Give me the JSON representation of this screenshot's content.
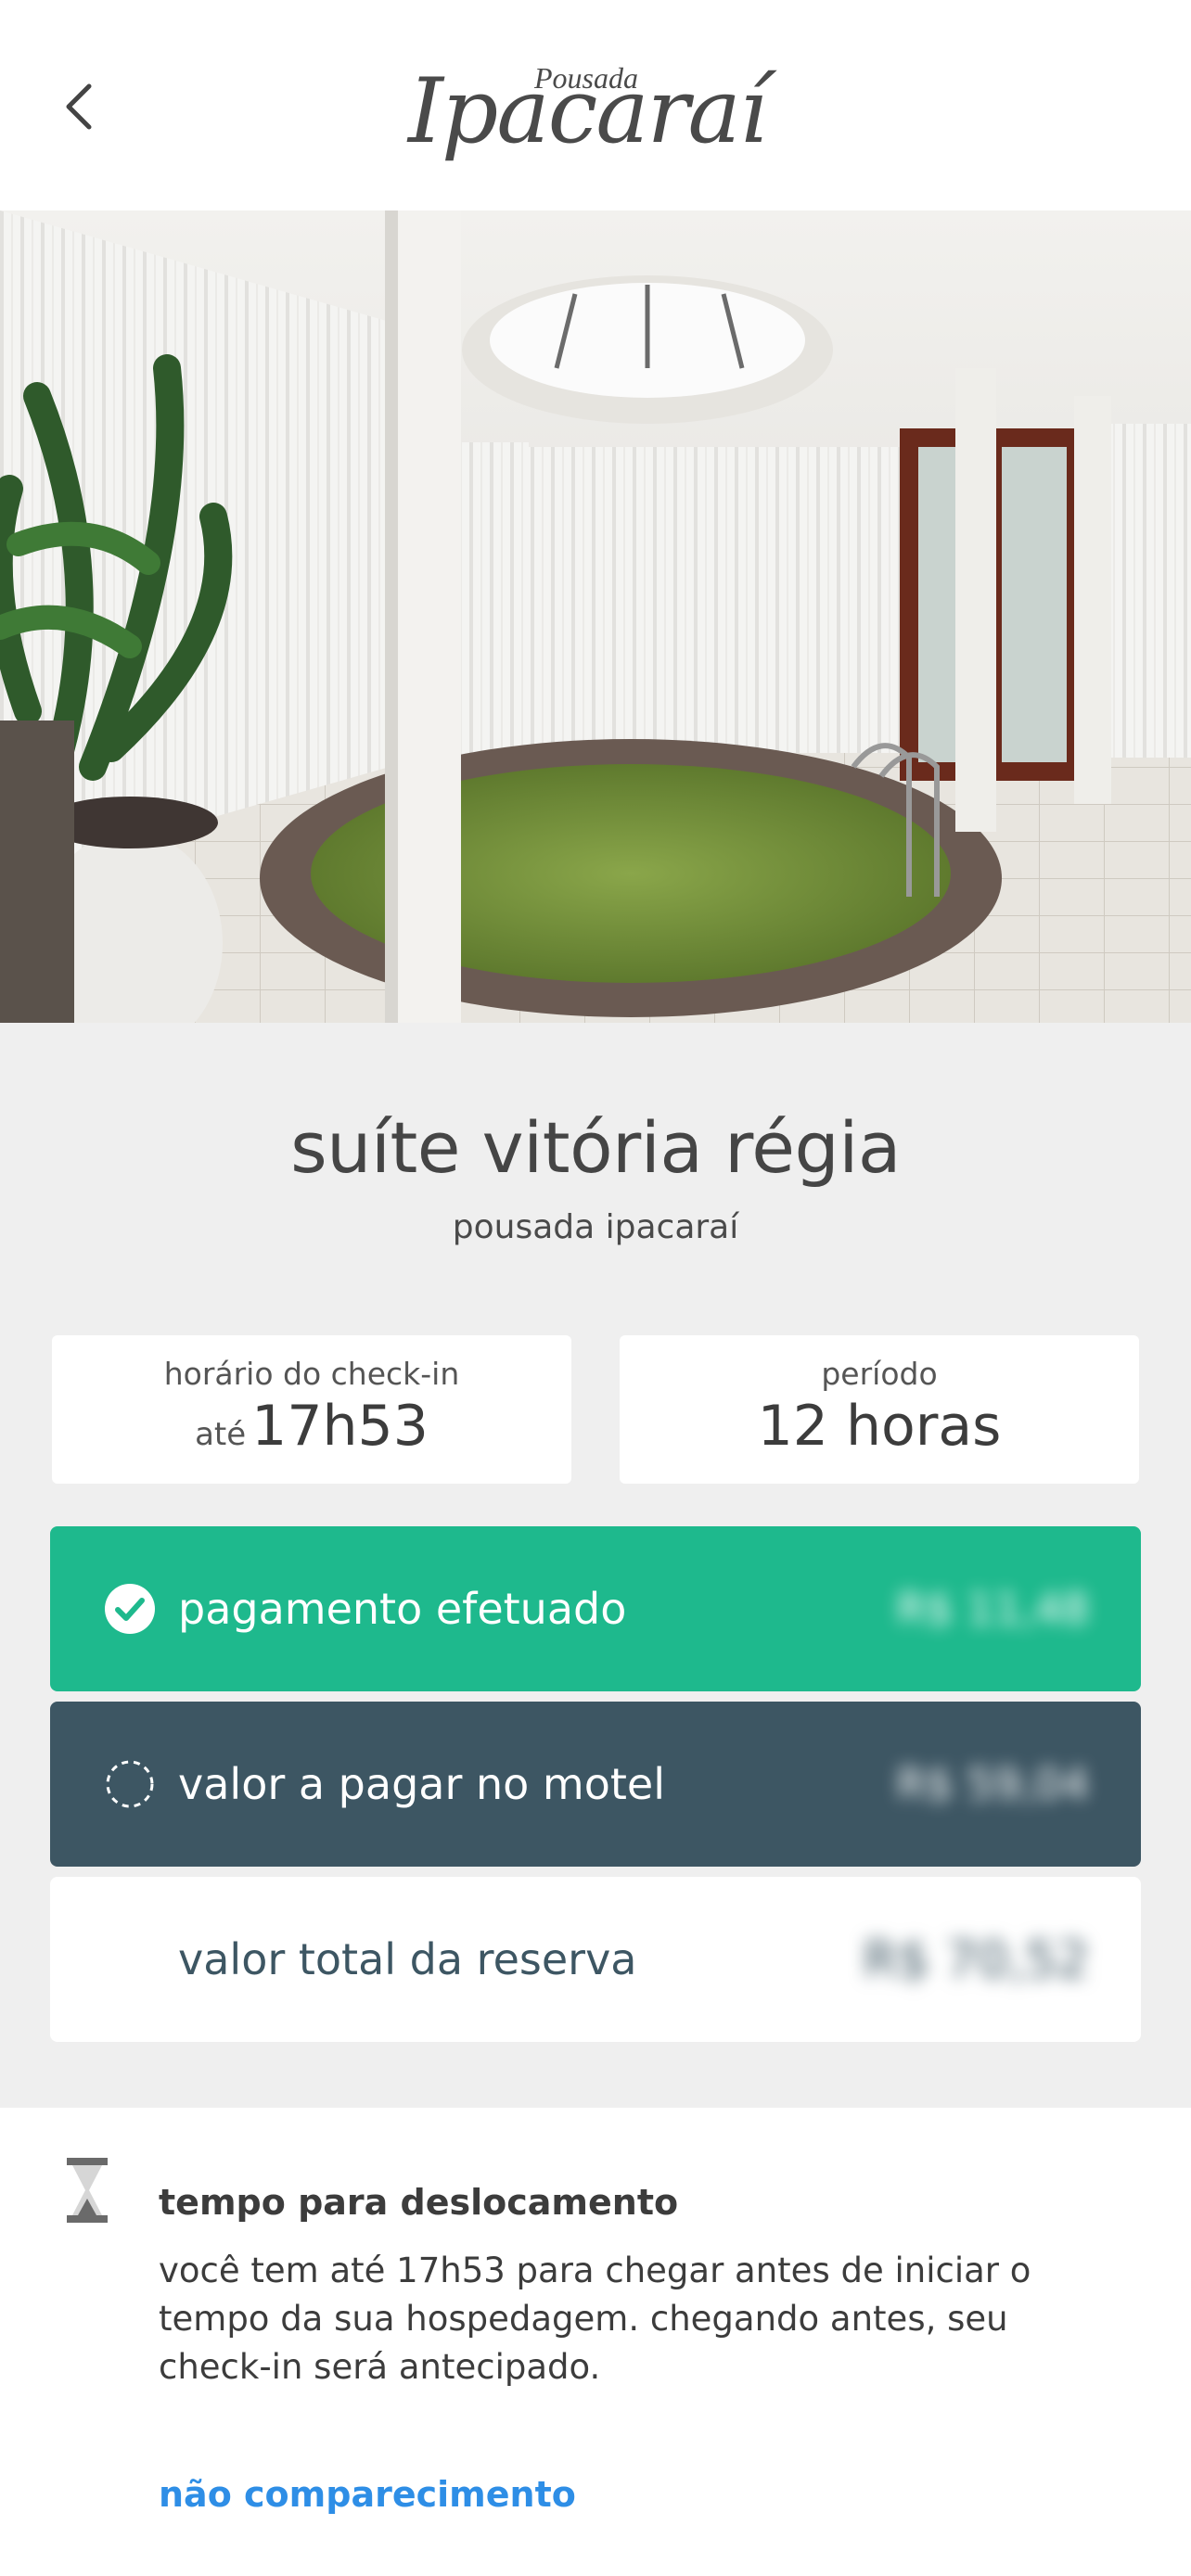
{
  "header": {
    "logo_small": "Pousada",
    "logo_script": "Ipacaraí"
  },
  "room": {
    "title": "suíte vitória régia",
    "subtitle": "pousada ipacaraí",
    "checkin_label": "horário do check-in",
    "checkin_prefix": "até",
    "checkin_value": "17h53",
    "period_label": "período",
    "period_value": "12 horas"
  },
  "payments": {
    "paid_label": "pagamento efetuado",
    "paid_amount": "R$ 11,48",
    "due_label": "valor a pagar no motel",
    "due_amount": "R$ 59,04",
    "total_label": "valor total da reserva",
    "total_amount": "R$ 70,52"
  },
  "travel": {
    "title": "tempo para deslocamento",
    "text": "você tem até 17h53 para chegar antes de iniciar o tempo da sua hospedagem. chegando antes, seu check-in será antecipado.",
    "link": "não comparecimento"
  },
  "colors": {
    "paid": "#1eb98d",
    "due": "#3d5663",
    "link": "#2e8ee6"
  }
}
